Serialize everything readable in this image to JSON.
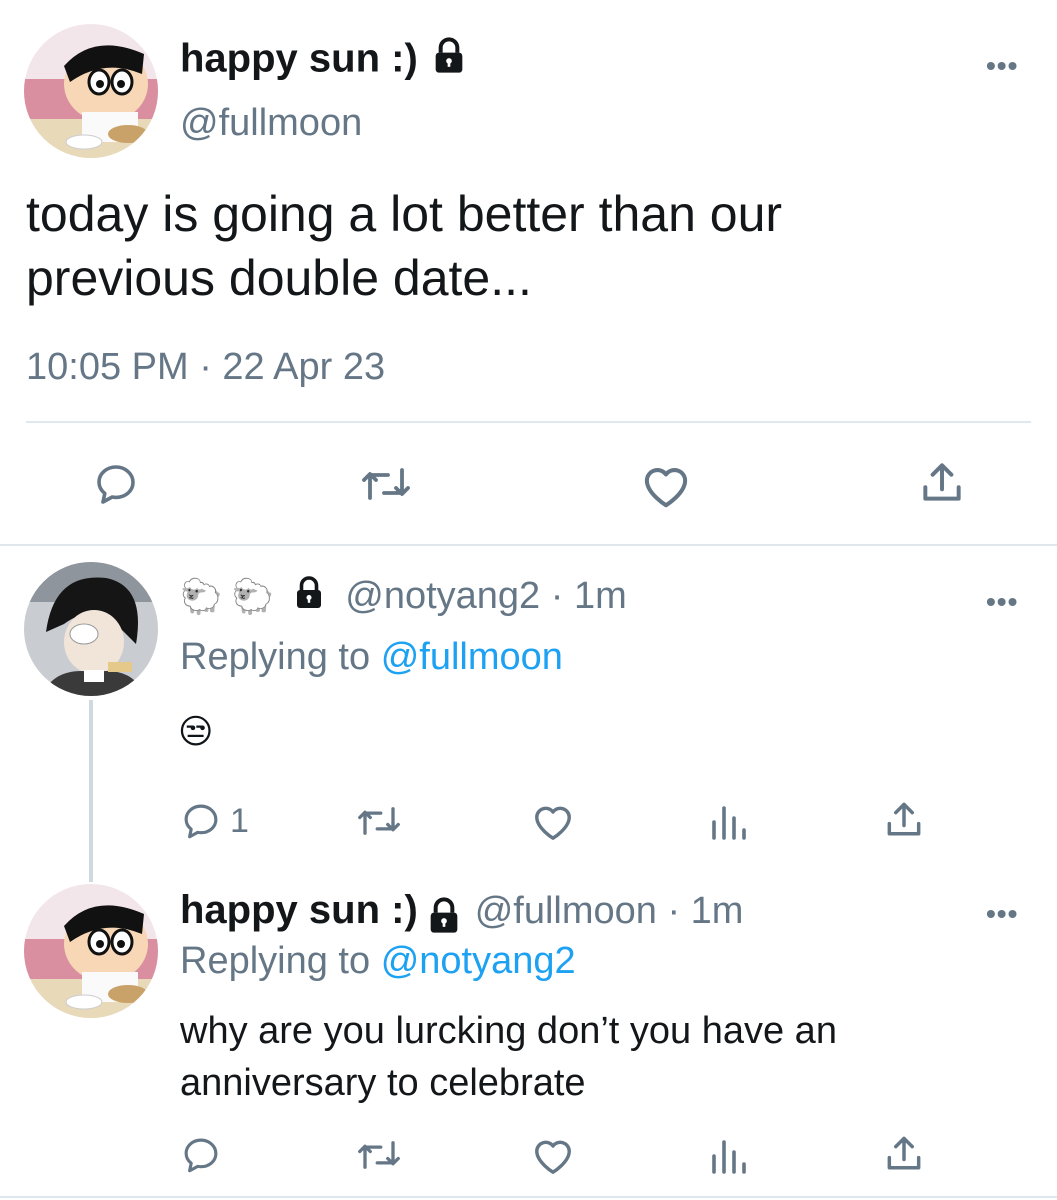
{
  "main_tweet": {
    "display_name": "happy sun :)",
    "handle": "@fullmoon",
    "text_line1": "today is going a lot better than our",
    "text_line2": "previous double date...",
    "timestamp": "10:05 PM · 22 Apr 23",
    "actions": [
      "reply-icon",
      "retweet-icon",
      "like-icon",
      "share-icon"
    ]
  },
  "reply1": {
    "display_name": "🐑 🐑",
    "handle_meta": "@notyang2 · 1m",
    "replying_prefix": "Replying to",
    "replying_to": "@fullmoon",
    "text": "😒",
    "reply_count": "1"
  },
  "reply2": {
    "display_name": "happy sun :)",
    "handle_meta": "@fullmoon · 1m",
    "replying_prefix": "Replying to",
    "replying_to": "@notyang2",
    "text_line1": "why are you lurcking don’t you have an",
    "text_line2": "anniversary to celebrate"
  },
  "more_label": "•••",
  "colors": {
    "accent": "#1da1f2",
    "muted": "#657786",
    "divider": "#e1e8ed"
  }
}
